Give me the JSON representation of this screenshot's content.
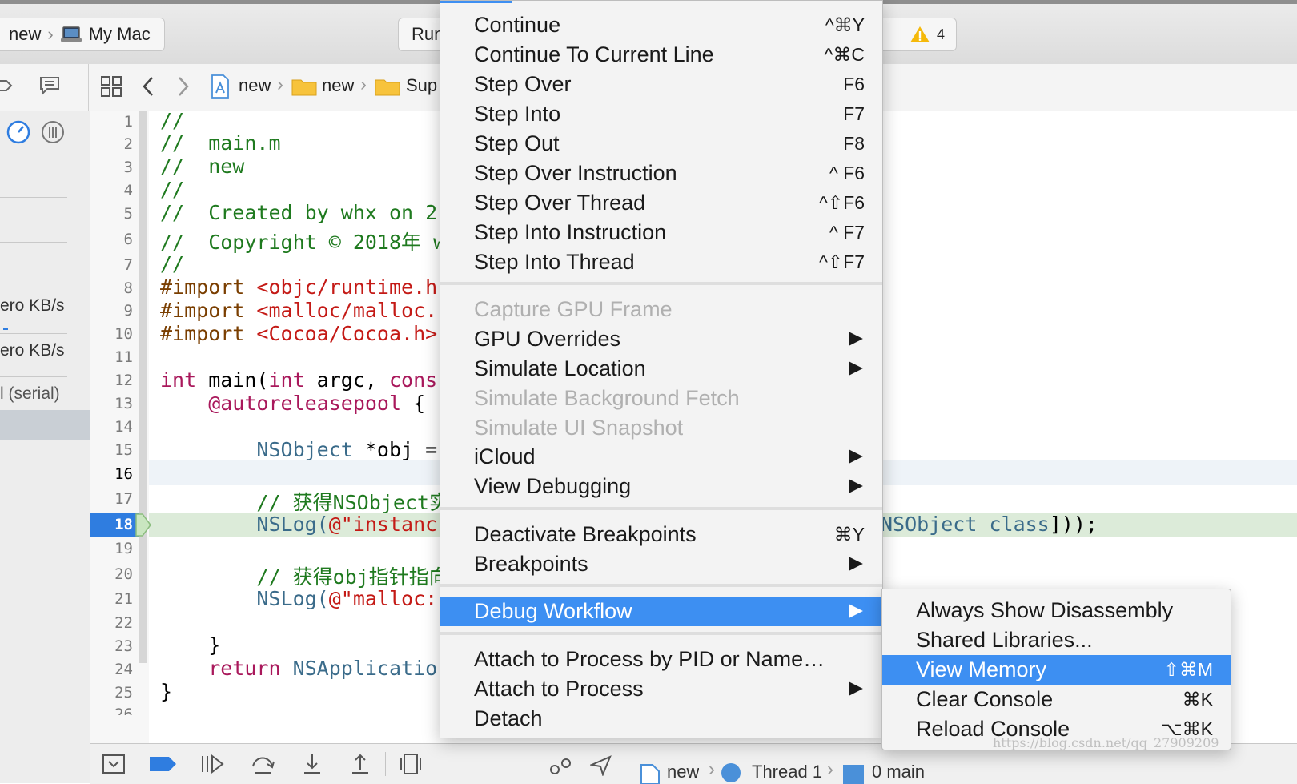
{
  "toolbar": {
    "scheme": "new",
    "destination": "My Mac",
    "status_label": "Run",
    "warnings": "4"
  },
  "jumpbar": {
    "items": [
      "new",
      "new",
      "Sup"
    ]
  },
  "sidebar": {
    "rate1": "ero KB/s",
    "rate2": "ero KB/s",
    "queue": "l (serial)"
  },
  "editor": {
    "current_line": "18",
    "line_numbers": [
      "1",
      "2",
      "3",
      "4",
      "5",
      "6",
      "7",
      "8",
      "9",
      "10",
      "11",
      "12",
      "13",
      "14",
      "15",
      "16",
      "17",
      "18",
      "19",
      "20",
      "21",
      "22",
      "23",
      "24",
      "25",
      "26"
    ],
    "lines": {
      "l1": "//",
      "l2": "//  main.m",
      "l3": "//  new",
      "l4": "//",
      "l5": "//  Created by whx on 2",
      "l6": "//  Copyright © 2018年 w",
      "l7": "//",
      "l8_kw": "#import",
      "l8_str": "<objc/runtime.h",
      "l9_kw": "#import",
      "l9_str": "<malloc/malloc.",
      "l10_kw": "#import",
      "l10_str": "<Cocoa/Cocoa.h>",
      "l12_a": "int",
      "l12_b": " main(",
      "l12_c": "int",
      "l12_d": " argc, ",
      "l12_e": "cons",
      "l13_a": "    @autoreleasepool",
      "l13_b": " {",
      "l15_a": "        NSObject",
      "l15_b": " *obj =",
      "l17": "        // 获得NSObject实",
      "l18_a": "        NSLog(",
      "l18_b": "@\"instanc",
      "l18_tail_a": "NSObject class",
      "l18_tail_b": "]));",
      "l20": "        // 获得obj指针指向",
      "l21_a": "        NSLog(",
      "l21_b": "@\"malloc:",
      "l23": "    }",
      "l24_a": "    return",
      "l24_b": " NSApplicatio",
      "l25": "}"
    }
  },
  "debugbar": {
    "path": [
      "new",
      "Thread 1",
      "0 main"
    ]
  },
  "debug_menu": {
    "items": [
      {
        "label": "Continue",
        "shortcut": "^⌘Y"
      },
      {
        "label": "Continue To Current Line",
        "shortcut": "^⌘C"
      },
      {
        "label": "Step Over",
        "shortcut": "F6"
      },
      {
        "label": "Step Into",
        "shortcut": "F7"
      },
      {
        "label": "Step Out",
        "shortcut": "F8"
      },
      {
        "label": "Step Over Instruction",
        "shortcut": "^ F6"
      },
      {
        "label": "Step Over Thread",
        "shortcut": "^⇧F6"
      },
      {
        "label": "Step Into Instruction",
        "shortcut": "^ F7"
      },
      {
        "label": "Step Into Thread",
        "shortcut": "^⇧F7"
      },
      {
        "label": "Capture GPU Frame"
      },
      {
        "label": "GPU Overrides"
      },
      {
        "label": "Simulate Location"
      },
      {
        "label": "Simulate Background Fetch"
      },
      {
        "label": "Simulate UI Snapshot"
      },
      {
        "label": "iCloud"
      },
      {
        "label": "View Debugging"
      },
      {
        "label": "Deactivate Breakpoints",
        "shortcut": "⌘Y"
      },
      {
        "label": "Breakpoints"
      },
      {
        "label": "Debug Workflow"
      },
      {
        "label": "Attach to Process by PID or Name…"
      },
      {
        "label": "Attach to Process"
      },
      {
        "label": "Detach"
      }
    ]
  },
  "workflow_submenu": {
    "items": [
      {
        "label": "Always Show Disassembly"
      },
      {
        "label": "Shared Libraries..."
      },
      {
        "label": "View Memory",
        "shortcut": "⇧⌘M"
      },
      {
        "label": "Clear Console",
        "shortcut": "⌘K"
      },
      {
        "label": "Reload Console",
        "shortcut": "⌥⌘K"
      }
    ]
  },
  "watermark": "https://blog.csdn.net/qq_27909209",
  "colors": {
    "menu_highlight": "#3d8ff2",
    "comment": "#1f7a1f",
    "string": "#c41a16",
    "keyword": "#a9185b",
    "breakpoint": "#2f7de0"
  }
}
